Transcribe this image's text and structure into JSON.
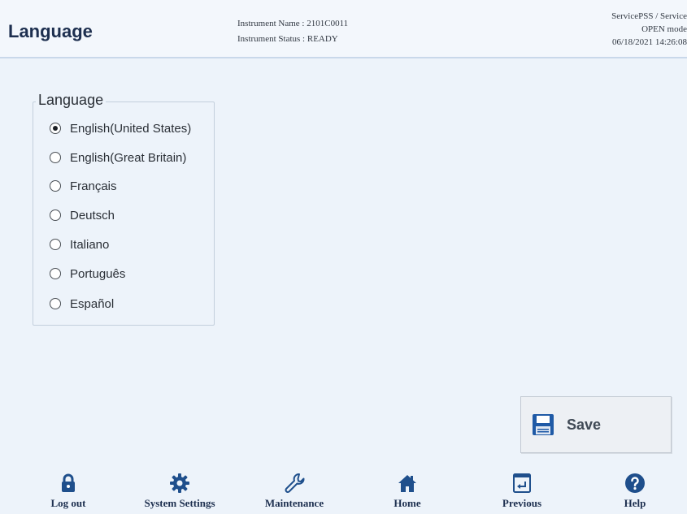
{
  "header": {
    "title": "Language",
    "instrument_name": "Instrument Name : 2101C0011",
    "instrument_status": "Instrument Status : READY",
    "user": "ServicePSS / Service",
    "mode": "OPEN mode",
    "datetime": "06/18/2021 14:26:08"
  },
  "language_group": {
    "legend": "Language",
    "options": [
      {
        "label": "English(United States)",
        "selected": true
      },
      {
        "label": "English(Great Britain)",
        "selected": false
      },
      {
        "label": "Français",
        "selected": false
      },
      {
        "label": "Deutsch",
        "selected": false
      },
      {
        "label": "Italiano",
        "selected": false
      },
      {
        "label": "Português",
        "selected": false
      },
      {
        "label": "Español",
        "selected": false
      }
    ]
  },
  "save_button": {
    "label": "Save",
    "icon": "floppy-disk-icon"
  },
  "nav": [
    {
      "label": "Log out",
      "icon": "lock-icon"
    },
    {
      "label": "System Settings",
      "icon": "gear-icon"
    },
    {
      "label": "Maintenance",
      "icon": "wrench-icon"
    },
    {
      "label": "Home",
      "icon": "home-icon"
    },
    {
      "label": "Previous",
      "icon": "previous-icon"
    },
    {
      "label": "Help",
      "icon": "help-icon"
    }
  ],
  "colors": {
    "background": "#edf3fa",
    "accent": "#1d2f4f",
    "icon_blue": "#1f4f8c"
  }
}
